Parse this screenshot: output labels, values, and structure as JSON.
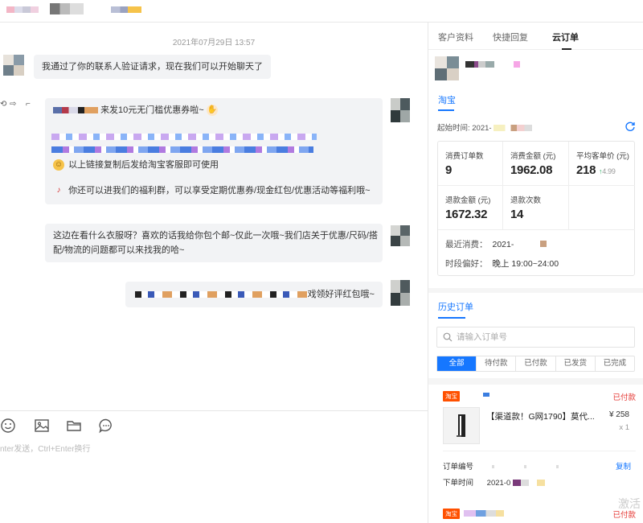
{
  "chat": {
    "timestamp": "2021年07月29日 13:57",
    "messages": [
      {
        "text": "我通过了你的联系人验证请求，现在我们可以开始聊天了"
      },
      {
        "lines": [
          "来发10元无门槛优惠券啦~",
          "以上链接复制后发给淘宝客服即可使用",
          "你还可以进我们的福利群，可以享受定期优惠券/现金红包/优惠活动等福利哦~"
        ]
      },
      {
        "lines": [
          "这边在看什么衣服呀？喜欢的话我给你包个邮~仅此一次哦~我们店关于优惠/尺码/搭",
          "配/物流的问题都可以来找我的哈~"
        ]
      },
      {
        "text": "戏领好评红包哦~"
      }
    ]
  },
  "input": {
    "hint": "nter发送，Ctrl+Enter换行",
    "tools": [
      "emoji-icon",
      "image-icon",
      "folder-icon",
      "quick-reply-icon"
    ]
  },
  "panel": {
    "tabs": [
      "客户资料",
      "快捷回复",
      "云订单"
    ],
    "active_tab": "云订单",
    "platform": "淘宝",
    "start_time_label": "起始时间: 2021-",
    "stats": {
      "order_count_label": "消费订单数",
      "order_count": "9",
      "amount_label": "消费金额 (元)",
      "amount": "1962.08",
      "avg_label": "平均客单价 (元)",
      "avg": "218",
      "avg_trend": "4.99",
      "refund_amount_label": "退款金额 (元)",
      "refund_amount": "1672.32",
      "refund_count_label": "退款次数",
      "refund_count": "14",
      "recent_label": "最近消费：",
      "recent_value": "2021-",
      "pref_label": "时段偏好：",
      "pref_value": "晚上 19:00~24:00"
    },
    "history": {
      "title": "历史订单",
      "search_placeholder": "请输入订单号",
      "filters": [
        "全部",
        "待付款",
        "已付款",
        "已发货",
        "已完成"
      ],
      "active_filter": "全部"
    },
    "order": {
      "tag": "淘宝",
      "status": "已付款",
      "product_name": "【渠道款！G网1790】莫代...",
      "price": "¥ 258",
      "qty": "x 1",
      "order_no_label": "订单编号",
      "copy_label": "复制",
      "time_label": "下单时间",
      "time_value": "2021-0"
    },
    "order2": {
      "tag": "淘宝",
      "status": "已付款"
    },
    "watermark": "激活"
  },
  "colors": {
    "accent": "#1677ff",
    "taobao": "#ff5000",
    "paid": "#e53935",
    "bubble": "#f2f3f5"
  }
}
